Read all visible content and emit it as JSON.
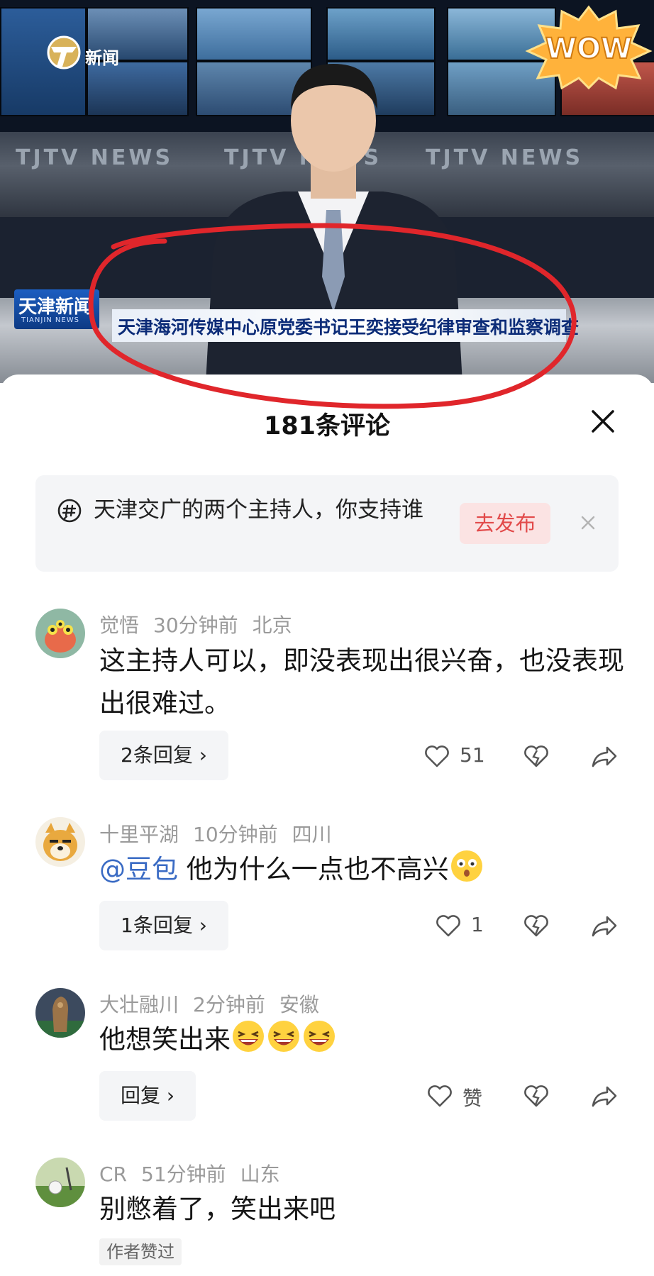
{
  "video": {
    "channel_logo_text": "新闻",
    "wow_sticker": "WOW",
    "wall_text": "TJTV NEWS",
    "lower_third_logo": "天津新闻",
    "lower_third_logo_sub": "TIANJIN NEWS",
    "headline": "天津海河传媒中心原党委书记王奕接受纪律审查和监察调查",
    "annotation_color": "#e0262b"
  },
  "sheet": {
    "title": "181条评论",
    "close_icon": "close-icon"
  },
  "topic": {
    "icon": "hashtag-icon",
    "text": "天津交广的两个主持人，你支持谁",
    "button_label": "去发布",
    "dismiss_icon": "close-icon"
  },
  "comments": [
    {
      "user": "觉悟",
      "time": "30分钟前",
      "location": "北京",
      "text": "这主持人可以，即没表现出很兴奋，也没表现出很难过。",
      "reply_label": "2条回复 ›",
      "likes": "51"
    },
    {
      "user": "十里平湖",
      "time": "10分钟前",
      "location": "四川",
      "mention": "@豆包",
      "text": " 他为什么一点也不高兴",
      "emoji": "surprised-emoji",
      "reply_label": "1条回复 ›",
      "likes": "1"
    },
    {
      "user": "大壮融川",
      "time": "2分钟前",
      "location": "安徽",
      "text": "他想笑出来",
      "emoji": "laughing-emoji",
      "reply_label": "回复 ›",
      "likes": "赞"
    },
    {
      "user": "CR",
      "time": "51分钟前",
      "location": "山东",
      "text": "别憋着了，笑出来吧",
      "badge": "作者赞过"
    }
  ]
}
